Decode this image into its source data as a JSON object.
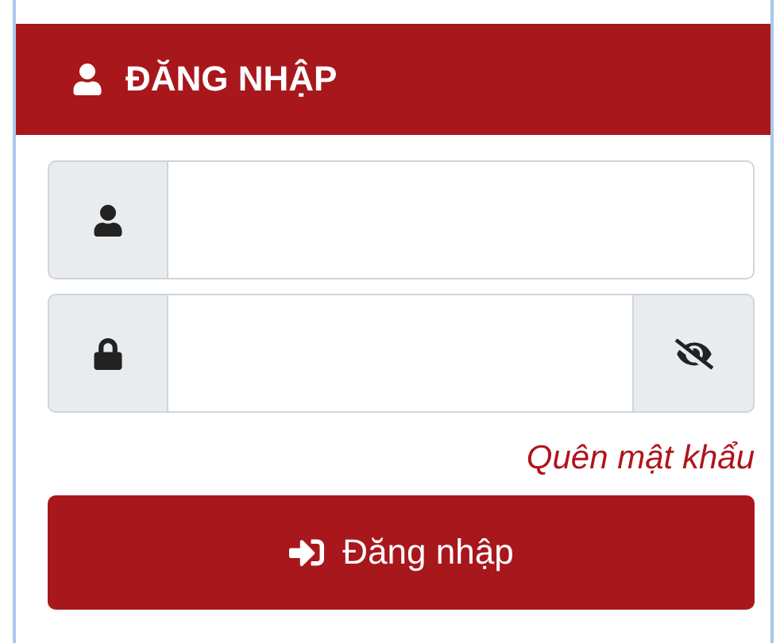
{
  "header": {
    "title": "ĐĂNG NHẬP"
  },
  "fields": [
    {
      "kind": "username"
    },
    {
      "kind": "password"
    }
  ],
  "forgot_link": "Quên mật khẩu",
  "submit_button": "Đăng nhập"
}
